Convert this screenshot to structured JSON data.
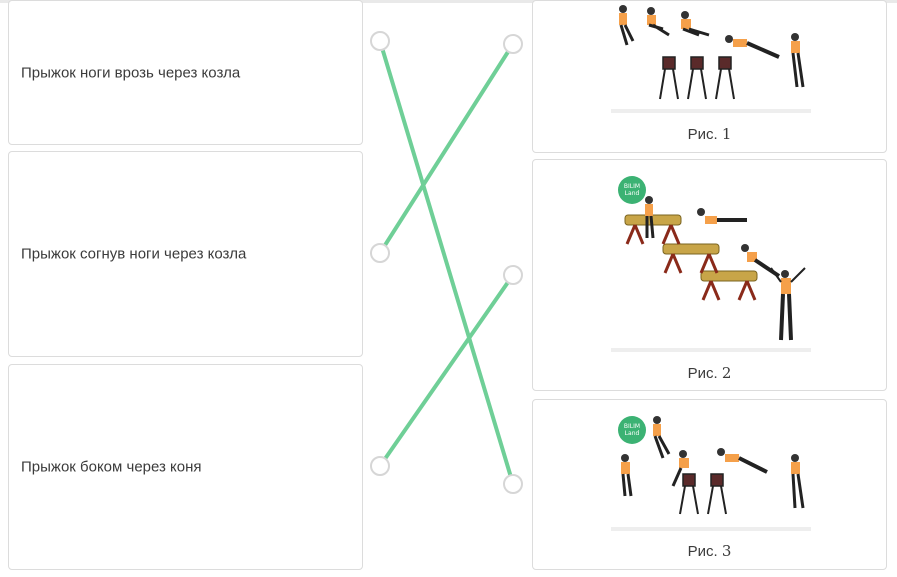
{
  "left_items": [
    {
      "label": "Прыжок ноги врозь через козла"
    },
    {
      "label": "Прыжок согнув ноги через козла"
    },
    {
      "label": "Прыжок боком через коня"
    }
  ],
  "right_items": [
    {
      "caption_prefix": "Рис.",
      "caption_number": "1",
      "illustration": "vault-sequence-icon"
    },
    {
      "caption_prefix": "Рис.",
      "caption_number": "2",
      "illustration": "pommel-horse-sequence-icon",
      "logo_text": "BILIM Land"
    },
    {
      "caption_prefix": "Рис.",
      "caption_number": "3",
      "illustration": "vault-sequence-icon",
      "logo_text": "BILIM Land"
    }
  ],
  "connections": [
    {
      "from": 1,
      "to": 3
    },
    {
      "from": 2,
      "to": 1
    },
    {
      "from": 3,
      "to": 2
    }
  ],
  "colors": {
    "line": "#6fcf97",
    "node_border": "#d6d6d6",
    "card_border": "#dcdcdc",
    "text": "#3b3b3b",
    "athlete_shirt": "#f5a04a",
    "horse_wood": "#c8a548",
    "logo": "#3bb273"
  }
}
